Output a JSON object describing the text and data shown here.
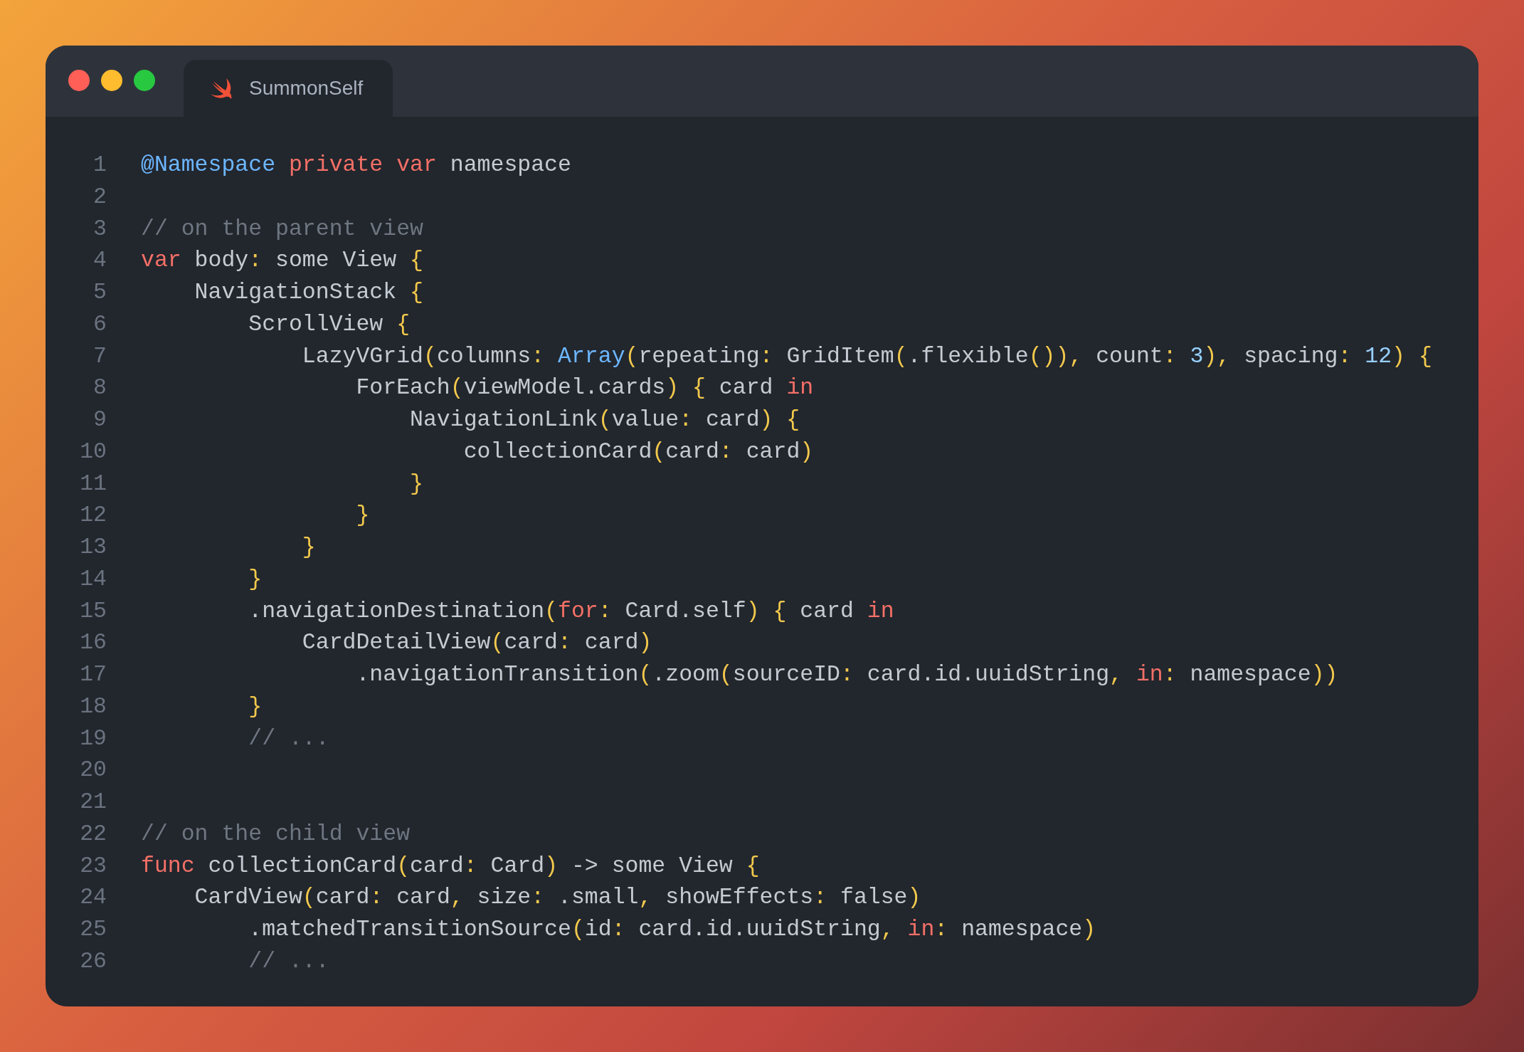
{
  "window": {
    "controls": [
      {
        "color": "#ff5f57"
      },
      {
        "color": "#febc2e"
      },
      {
        "color": "#28c840"
      }
    ],
    "tab": {
      "title": "SummonSelf"
    }
  },
  "code": {
    "lines": [
      {
        "number": "1",
        "tokens": [
          {
            "kind": "type",
            "text": "@Namespace "
          },
          {
            "kind": "keyword",
            "text": "private "
          },
          {
            "kind": "keyword",
            "text": "var"
          },
          {
            "kind": "plain",
            "text": " namespace"
          }
        ]
      },
      {
        "number": "2"
      },
      {
        "number": "3",
        "tokens": [
          {
            "kind": "comment",
            "text": "// on the parent view"
          }
        ]
      },
      {
        "number": "4",
        "tokens": [
          {
            "kind": "keyword",
            "text": "var"
          },
          {
            "kind": "plain",
            "text": " body"
          },
          {
            "kind": "punct",
            "text": ":"
          },
          {
            "kind": "plain",
            "text": " some View "
          },
          {
            "kind": "punct",
            "text": "{"
          }
        ]
      },
      {
        "number": "5",
        "tokens": [
          {
            "kind": "plain",
            "text": "    NavigationStack "
          },
          {
            "kind": "punct",
            "text": "{"
          }
        ]
      },
      {
        "number": "6",
        "tokens": [
          {
            "kind": "plain",
            "text": "        ScrollView "
          },
          {
            "kind": "punct",
            "text": "{"
          }
        ]
      },
      {
        "number": "7",
        "tokens": [
          {
            "kind": "plain",
            "text": "            LazyVGrid"
          },
          {
            "kind": "punct",
            "text": "("
          },
          {
            "kind": "plain",
            "text": "columns"
          },
          {
            "kind": "punct",
            "text": ": "
          },
          {
            "kind": "type",
            "text": "Array"
          },
          {
            "kind": "punct",
            "text": "("
          },
          {
            "kind": "plain",
            "text": "repeating"
          },
          {
            "kind": "punct",
            "text": ":"
          },
          {
            "kind": "plain",
            "text": " GridItem"
          },
          {
            "kind": "punct",
            "text": "("
          },
          {
            "kind": "plain",
            "text": ".flexible"
          },
          {
            "kind": "punct",
            "text": "()),"
          },
          {
            "kind": "plain",
            "text": " count"
          },
          {
            "kind": "punct",
            "text": ": "
          },
          {
            "kind": "number",
            "text": "3"
          },
          {
            "kind": "punct",
            "text": "),"
          },
          {
            "kind": "plain",
            "text": " spacing"
          },
          {
            "kind": "punct",
            "text": ": "
          },
          {
            "kind": "number",
            "text": "12"
          },
          {
            "kind": "punct",
            "text": ") {"
          }
        ]
      },
      {
        "number": "8",
        "tokens": [
          {
            "kind": "plain",
            "text": "                ForEach"
          },
          {
            "kind": "punct",
            "text": "("
          },
          {
            "kind": "plain",
            "text": "viewModel.cards"
          },
          {
            "kind": "punct",
            "text": ") {"
          },
          {
            "kind": "plain",
            "text": " card "
          },
          {
            "kind": "keyword",
            "text": "in"
          }
        ]
      },
      {
        "number": "9",
        "tokens": [
          {
            "kind": "plain",
            "text": "                    NavigationLink"
          },
          {
            "kind": "punct",
            "text": "("
          },
          {
            "kind": "plain",
            "text": "value"
          },
          {
            "kind": "punct",
            "text": ":"
          },
          {
            "kind": "plain",
            "text": " card"
          },
          {
            "kind": "punct",
            "text": ") {"
          }
        ]
      },
      {
        "number": "10",
        "tokens": [
          {
            "kind": "plain",
            "text": "                        collectionCard"
          },
          {
            "kind": "punct",
            "text": "("
          },
          {
            "kind": "plain",
            "text": "card"
          },
          {
            "kind": "punct",
            "text": ":"
          },
          {
            "kind": "plain",
            "text": " card"
          },
          {
            "kind": "punct",
            "text": ")"
          }
        ]
      },
      {
        "number": "11",
        "tokens": [
          {
            "kind": "punct",
            "text": "                    }"
          }
        ]
      },
      {
        "number": "12",
        "tokens": [
          {
            "kind": "punct",
            "text": "                }"
          }
        ]
      },
      {
        "number": "13",
        "tokens": [
          {
            "kind": "punct",
            "text": "            }"
          }
        ]
      },
      {
        "number": "14",
        "tokens": [
          {
            "kind": "punct",
            "text": "        }"
          }
        ]
      },
      {
        "number": "15",
        "tokens": [
          {
            "kind": "plain",
            "text": "        .navigationDestination"
          },
          {
            "kind": "punct",
            "text": "("
          },
          {
            "kind": "keyword",
            "text": "for"
          },
          {
            "kind": "punct",
            "text": ":"
          },
          {
            "kind": "plain",
            "text": " Card.self"
          },
          {
            "kind": "punct",
            "text": ") {"
          },
          {
            "kind": "plain",
            "text": " card "
          },
          {
            "kind": "keyword",
            "text": "in"
          }
        ]
      },
      {
        "number": "16",
        "tokens": [
          {
            "kind": "plain",
            "text": "            CardDetailView"
          },
          {
            "kind": "punct",
            "text": "("
          },
          {
            "kind": "plain",
            "text": "card"
          },
          {
            "kind": "punct",
            "text": ":"
          },
          {
            "kind": "plain",
            "text": " card"
          },
          {
            "kind": "punct",
            "text": ")"
          }
        ]
      },
      {
        "number": "17",
        "tokens": [
          {
            "kind": "plain",
            "text": "                .navigationTransition"
          },
          {
            "kind": "punct",
            "text": "("
          },
          {
            "kind": "plain",
            "text": ".zoom"
          },
          {
            "kind": "punct",
            "text": "("
          },
          {
            "kind": "plain",
            "text": "sourceID"
          },
          {
            "kind": "punct",
            "text": ":"
          },
          {
            "kind": "plain",
            "text": " card.id.uuidString"
          },
          {
            "kind": "punct",
            "text": ", "
          },
          {
            "kind": "keyword",
            "text": "in"
          },
          {
            "kind": "punct",
            "text": ":"
          },
          {
            "kind": "plain",
            "text": " namespace"
          },
          {
            "kind": "punct",
            "text": "))"
          }
        ]
      },
      {
        "number": "18",
        "tokens": [
          {
            "kind": "punct",
            "text": "        }"
          }
        ]
      },
      {
        "number": "19",
        "tokens": [
          {
            "kind": "comment",
            "text": "        // ..."
          }
        ]
      },
      {
        "number": "20"
      },
      {
        "number": "21"
      },
      {
        "number": "22",
        "tokens": [
          {
            "kind": "comment",
            "text": "// on the child view"
          }
        ]
      },
      {
        "number": "23",
        "tokens": [
          {
            "kind": "keyword",
            "text": "func"
          },
          {
            "kind": "plain",
            "text": " collectionCard"
          },
          {
            "kind": "punct",
            "text": "("
          },
          {
            "kind": "plain",
            "text": "card"
          },
          {
            "kind": "punct",
            "text": ":"
          },
          {
            "kind": "plain",
            "text": " Card"
          },
          {
            "kind": "punct",
            "text": ")"
          },
          {
            "kind": "plain",
            "text": " -> some View "
          },
          {
            "kind": "punct",
            "text": "{"
          }
        ]
      },
      {
        "number": "24",
        "tokens": [
          {
            "kind": "plain",
            "text": "    CardView"
          },
          {
            "kind": "punct",
            "text": "("
          },
          {
            "kind": "plain",
            "text": "card"
          },
          {
            "kind": "punct",
            "text": ":"
          },
          {
            "kind": "plain",
            "text": " card"
          },
          {
            "kind": "punct",
            "text": ","
          },
          {
            "kind": "plain",
            "text": " size"
          },
          {
            "kind": "punct",
            "text": ":"
          },
          {
            "kind": "plain",
            "text": " .small"
          },
          {
            "kind": "punct",
            "text": ","
          },
          {
            "kind": "plain",
            "text": " showEffects"
          },
          {
            "kind": "punct",
            "text": ":"
          },
          {
            "kind": "plain",
            "text": " false"
          },
          {
            "kind": "punct",
            "text": ")"
          }
        ]
      },
      {
        "number": "25",
        "tokens": [
          {
            "kind": "plain",
            "text": "        .matchedTransitionSource"
          },
          {
            "kind": "punct",
            "text": "("
          },
          {
            "kind": "plain",
            "text": "id"
          },
          {
            "kind": "punct",
            "text": ":"
          },
          {
            "kind": "plain",
            "text": " card.id.uuidString"
          },
          {
            "kind": "punct",
            "text": ", "
          },
          {
            "kind": "keyword",
            "text": "in"
          },
          {
            "kind": "punct",
            "text": ":"
          },
          {
            "kind": "plain",
            "text": " namespace"
          },
          {
            "kind": "punct",
            "text": ")"
          }
        ]
      },
      {
        "number": "26",
        "tokens": [
          {
            "kind": "comment",
            "text": "        // ..."
          }
        ]
      }
    ]
  }
}
